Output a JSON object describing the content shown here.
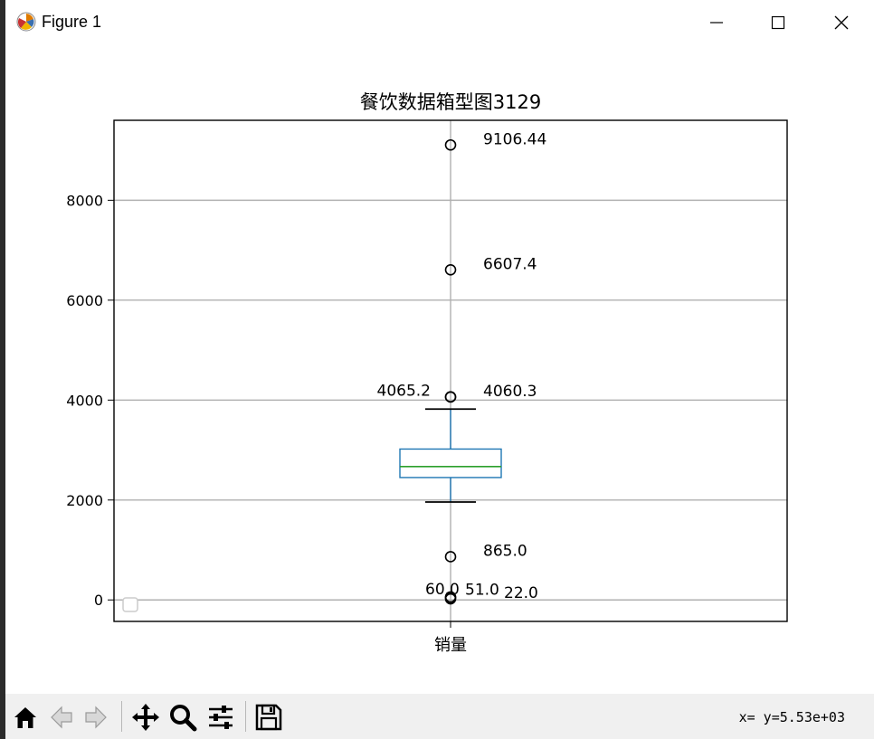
{
  "window": {
    "title": "Figure 1",
    "controls": [
      "minimize",
      "maximize",
      "close"
    ]
  },
  "chart_data": {
    "type": "box",
    "title": "餐饮数据箱型图3129",
    "category_label": "销量",
    "ylim": [
      -430,
      9600
    ],
    "yticks": [
      0,
      2000,
      4000,
      6000,
      8000
    ],
    "grid": true,
    "box": {
      "q1": 2450,
      "median": 2670,
      "q3": 3020,
      "whisker_low": 1960,
      "whisker_high": 3820
    },
    "outliers": [
      {
        "value": 9106.44,
        "label": "9106.44",
        "side": "right"
      },
      {
        "value": 6607.4,
        "label": "6607.4",
        "side": "right"
      },
      {
        "value": 4065.2,
        "label": "4065.2",
        "side": "left"
      },
      {
        "value": 4060.3,
        "label": "4060.3",
        "side": "right"
      },
      {
        "value": 865.0,
        "label": "865.0",
        "side": "right"
      },
      {
        "value": 60.0,
        "label": "60.0",
        "side": "left-low"
      },
      {
        "value": 51.0,
        "label": "51.0",
        "side": "right-low"
      },
      {
        "value": 22.0,
        "label": "22.0",
        "side": "right-far"
      }
    ],
    "legend": "lower-left, empty",
    "colors": {
      "box": "#1f77b4",
      "median": "#2ca02c",
      "whisker": "#000000",
      "outlier": "#000000",
      "grid": "#b0b0b0"
    }
  },
  "toolbar": {
    "buttons": [
      {
        "name": "home-icon",
        "label": "Home"
      },
      {
        "name": "back-icon",
        "label": "Back"
      },
      {
        "name": "forward-icon",
        "label": "Forward"
      },
      {
        "name": "pan-icon",
        "label": "Pan"
      },
      {
        "name": "zoom-icon",
        "label": "Zoom"
      },
      {
        "name": "configure-subplots-icon",
        "label": "Configure subplots"
      },
      {
        "name": "save-icon",
        "label": "Save"
      }
    ],
    "coordinates": "x= y=5.53e+03"
  }
}
